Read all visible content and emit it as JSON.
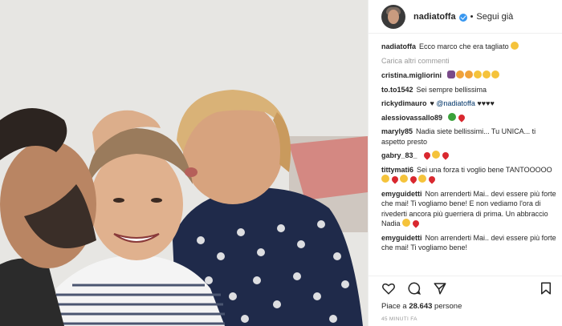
{
  "post": {
    "username": "nadiatoffa",
    "follow_separator": "•",
    "follow_label": "Segui già",
    "photo_alt": "Selfie di tre persone"
  },
  "caption": {
    "username": "nadiatoffa",
    "text": "Ecco marco che era tagliato"
  },
  "load_more_label": "Carica altri commenti",
  "comments": [
    {
      "username": "cristina.migliorini",
      "text": ""
    },
    {
      "username": "to.to1542",
      "text": "Sei sempre bellissima"
    },
    {
      "username": "rickydimauro",
      "text": "♥",
      "mention": "@nadiatoffa",
      "after": "♥♥♥♥"
    },
    {
      "username": "alessiovassallo89",
      "text": ""
    },
    {
      "username": "maryly85",
      "text": "Nadia siete bellissimi... Tu UNICA... ti aspetto presto"
    },
    {
      "username": "gabry_83_",
      "text": ""
    },
    {
      "username": "tittymati6",
      "text": "Sei una forza ti voglio bene TANTOOOOO"
    },
    {
      "username": "emyguidetti",
      "text": "Non arrenderti Mai.. devi essere più forte che mai! Ti vogliamo bene! E non vediamo l'ora di rivederti ancora più guerriera di prima. Un abbraccio Nadia"
    },
    {
      "username": "emyguidetti",
      "text": "Non arrenderti Mai.. devi essere più forte che mai! Ti vogliamo bene!"
    }
  ],
  "likes": {
    "prefix": "Piace a",
    "count": "28.643",
    "suffix": "persone"
  },
  "timestamp": "45 minuti fa",
  "icons": {
    "like": "heart-icon",
    "comment": "comment-icon",
    "share": "share-icon",
    "save": "bookmark-icon"
  }
}
